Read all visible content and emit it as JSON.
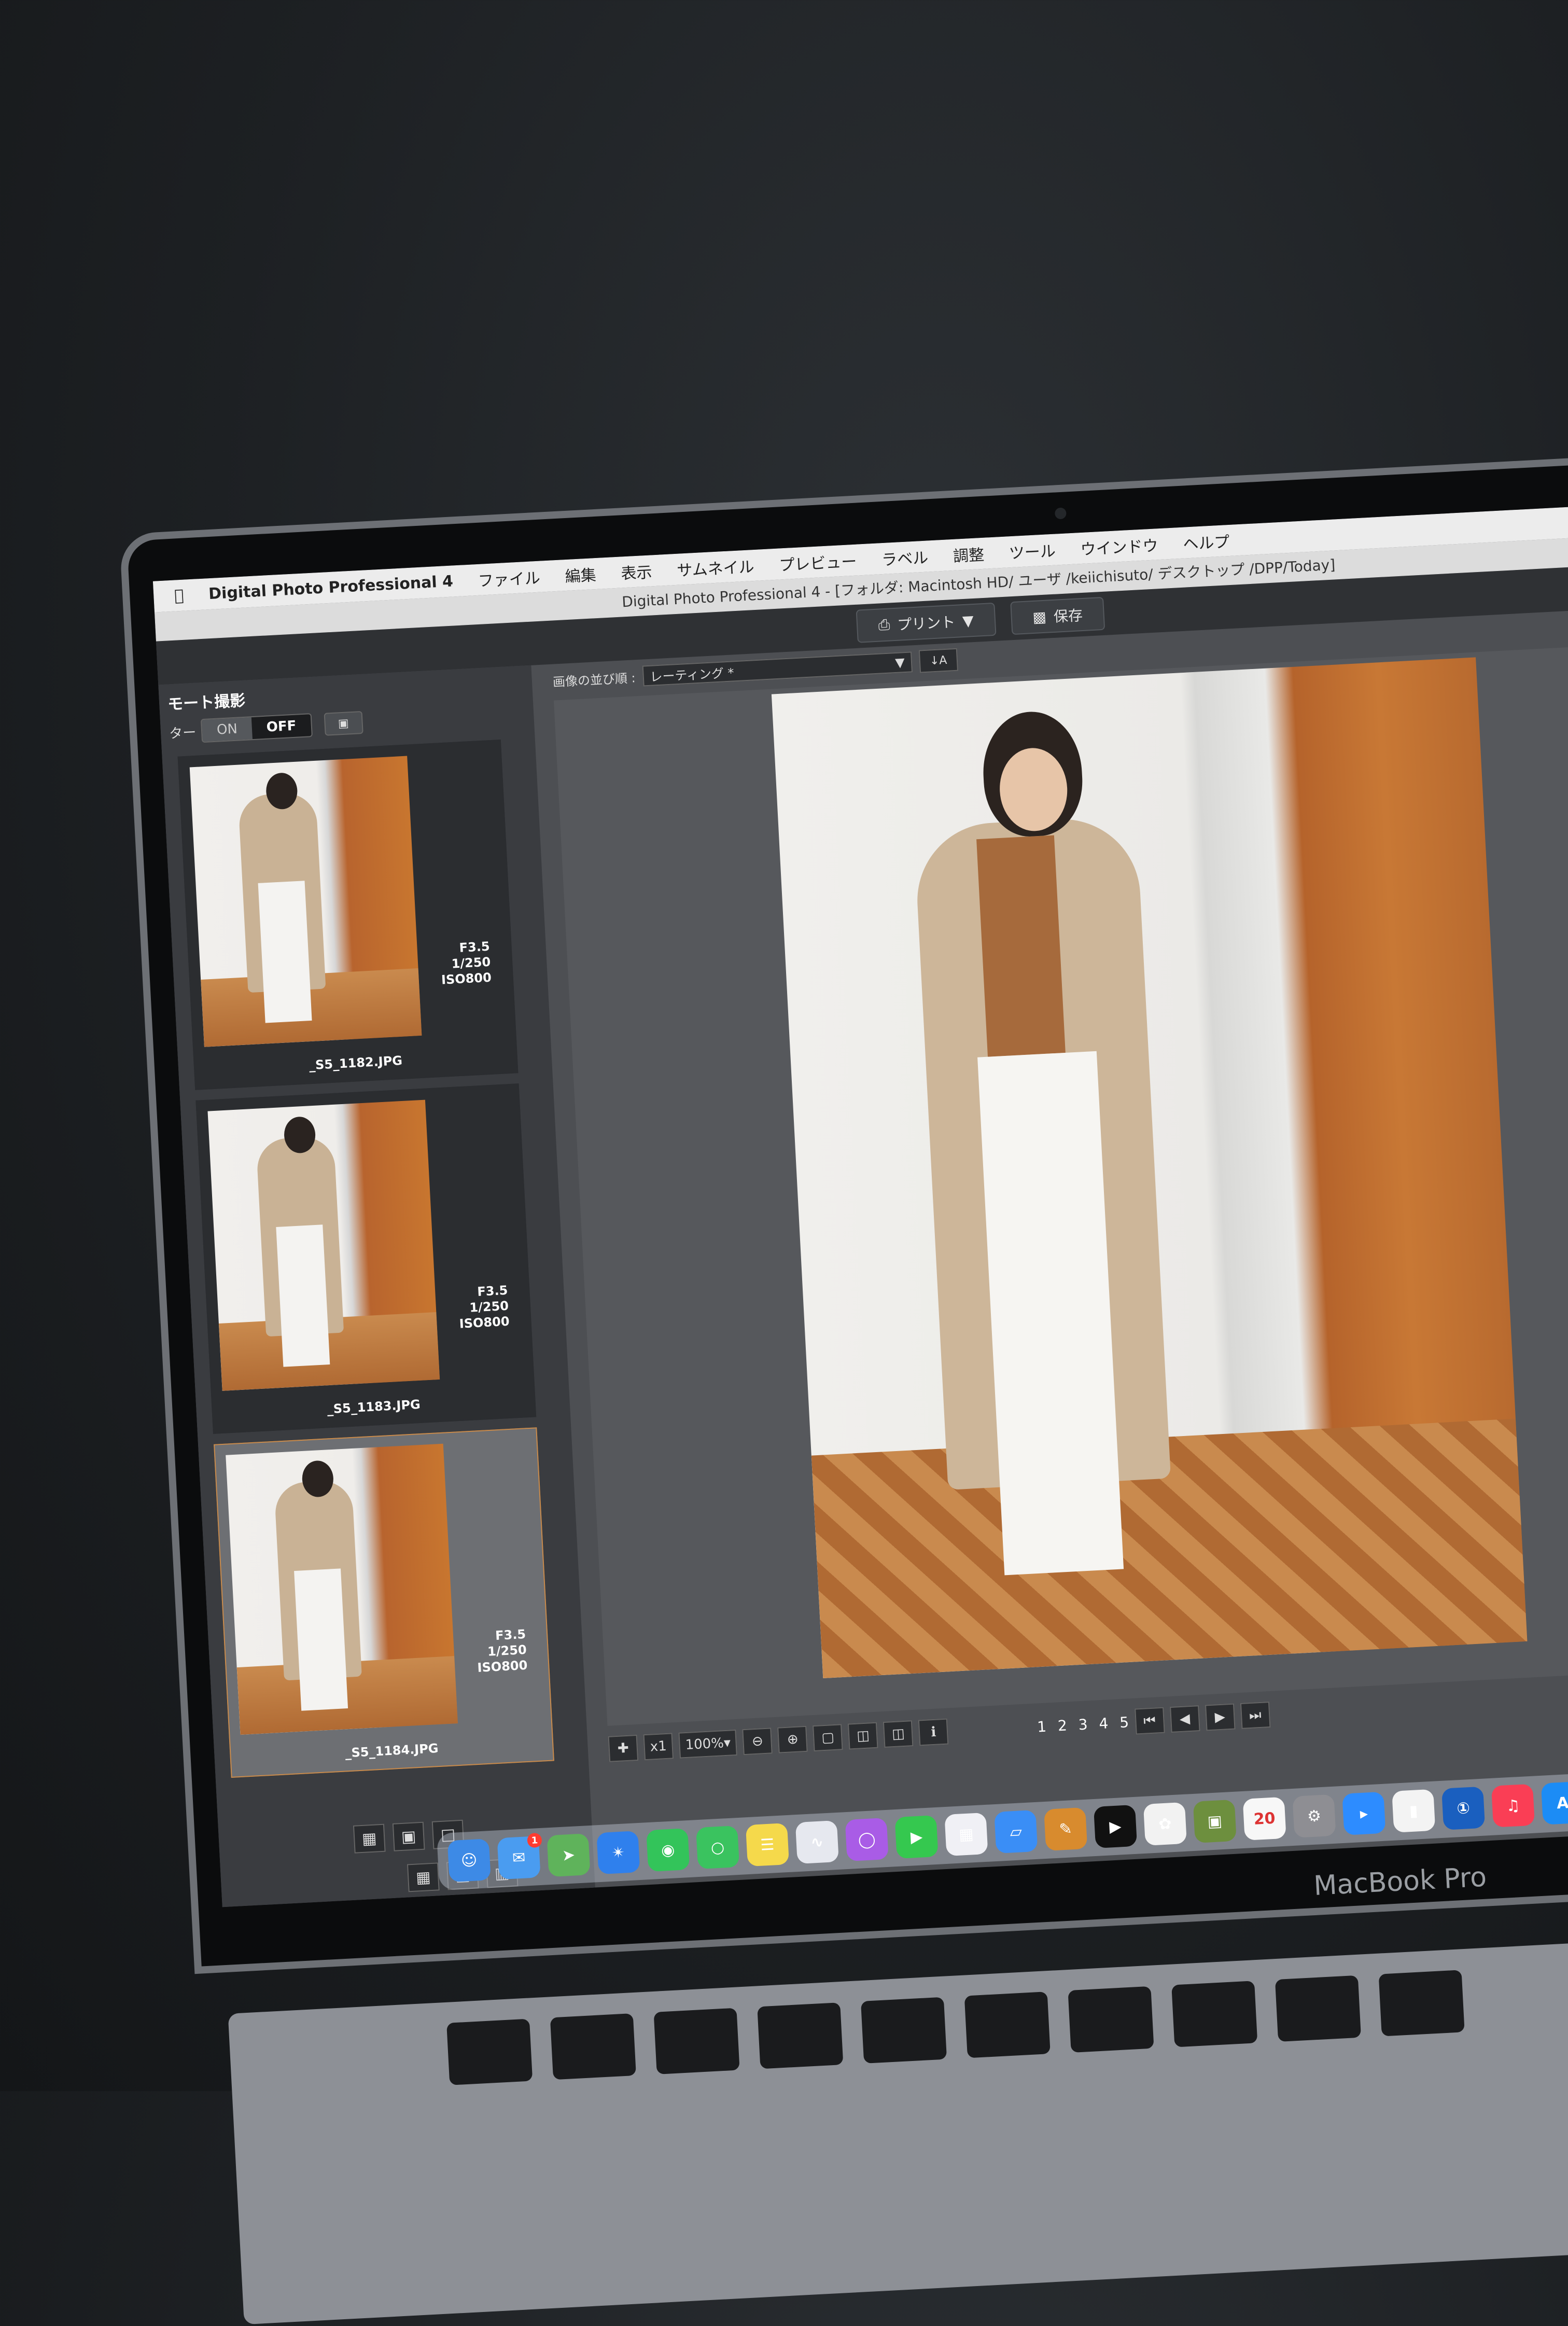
{
  "menubar": {
    "app_name": "Digital Photo Professional 4",
    "items": [
      "ファイル",
      "編集",
      "表示",
      "サムネイル",
      "プレビュー",
      "ラベル",
      "調整",
      "ツール",
      "ウインドウ",
      "ヘルプ"
    ]
  },
  "titlebar": {
    "title": "Digital Photo Professional 4 - [フォルダ: Macintosh HD/ ユーザ /keiichisuto/ デスクトップ /DPP/Today]"
  },
  "toolbar": {
    "print_label": "プリント",
    "save_label": "保存"
  },
  "left_panel": {
    "title": "モート撮影",
    "toggle_label": "ター",
    "toggle_on": "ON",
    "toggle_off": "OFF",
    "thumbnails": [
      {
        "filename": "_S5_1182.JPG",
        "aperture": "F3.5",
        "shutter": "1/250",
        "iso": "ISO800"
      },
      {
        "filename": "_S5_1183.JPG",
        "aperture": "F3.5",
        "shutter": "1/250",
        "iso": "ISO800"
      },
      {
        "filename": "_S5_1184.JPG",
        "aperture": "F3.5",
        "shutter": "1/250",
        "iso": "ISO800"
      }
    ]
  },
  "sort": {
    "label": "画像の並び順 :",
    "value": "レーティング *"
  },
  "statusbar": {
    "magnification": "x1",
    "zoom": "100%",
    "ratings": [
      "1",
      "2",
      "3",
      "4",
      "5"
    ]
  },
  "dock": {
    "mail_badge": "1",
    "calendar_day": "20"
  },
  "device_label": "MacBook Pro"
}
